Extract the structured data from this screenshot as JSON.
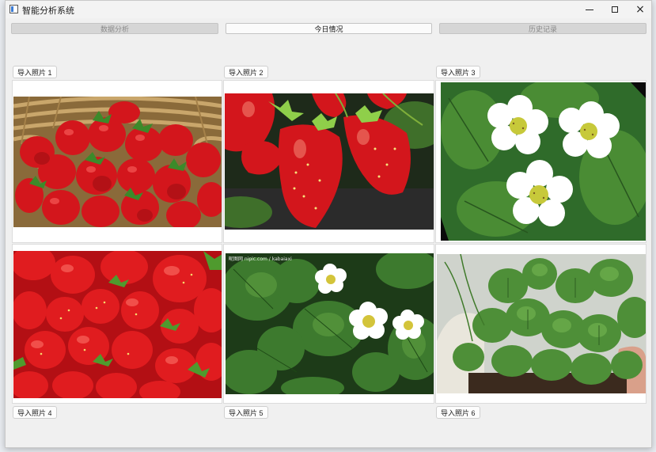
{
  "window": {
    "title": "智能分析系统",
    "icon": "app-window-icon",
    "controls": {
      "minimize": "minimize-icon",
      "maximize": "maximize-icon",
      "close": "×"
    }
  },
  "tabs": [
    {
      "label": "数据分析",
      "state": "disabled"
    },
    {
      "label": "今日情况",
      "state": "active"
    },
    {
      "label": "历史记录",
      "state": "disabled"
    }
  ],
  "imports": [
    {
      "label": "导入照片 1",
      "image": "strawberries in basket"
    },
    {
      "label": "导入照片 2",
      "image": "strawberries on plant"
    },
    {
      "label": "导入照片 3",
      "image": "white strawberry flowers"
    },
    {
      "label": "导入照片 4",
      "image": "pile of strawberries"
    },
    {
      "label": "导入照片 5",
      "image": "strawberry leaves and flowers"
    },
    {
      "label": "导入照片 6",
      "image": "potted strawberry plant"
    }
  ],
  "photo5_watermark": "昵图网 nipic.com / kabaiaxi",
  "colors": {
    "strawberry_red": "#d8161b",
    "leaf_green": "#3d7a2e",
    "flower_white": "#ffffff",
    "disabled_tab": "#d6d6d6",
    "active_tab": "#fbfbfb"
  }
}
